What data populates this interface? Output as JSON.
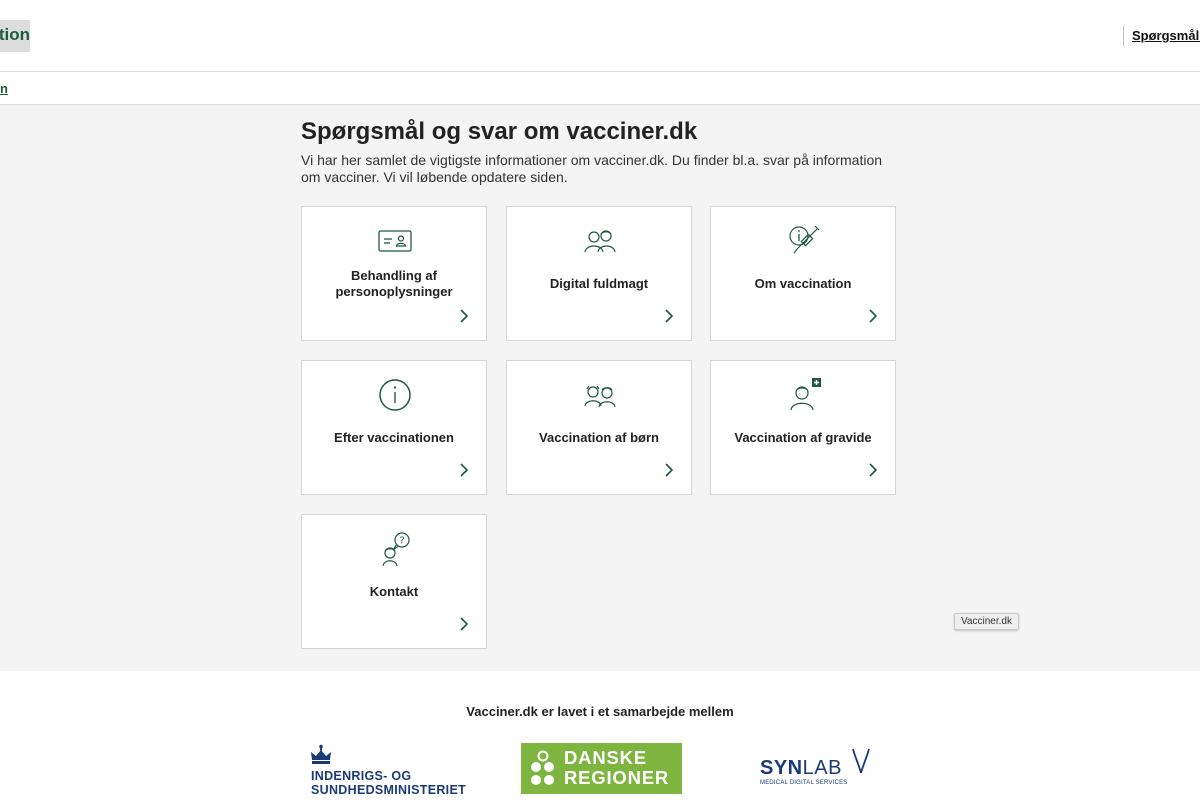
{
  "header": {
    "logo_text": "tion",
    "nav_link": "Spørgsmål o"
  },
  "subnav": {
    "link": "n"
  },
  "main": {
    "title": "Spørgsmål og svar om vacciner.dk",
    "intro": "Vi har her samlet de vigtigste informationer om vacciner.dk. Du finder bl.a. svar på information om vacciner. Vi vil løbende opdatere siden.",
    "cards": [
      {
        "title": "Behandling af personoplysninger",
        "icon": "id-card-icon"
      },
      {
        "title": "Digital fuldmagt",
        "icon": "two-people-icon"
      },
      {
        "title": "Om vaccination",
        "icon": "info-syringe-icon"
      },
      {
        "title": "Efter vaccinationen",
        "icon": "info-circle-icon"
      },
      {
        "title": "Vaccination af børn",
        "icon": "children-icon"
      },
      {
        "title": "Vaccination af gravide",
        "icon": "pregnant-person-icon"
      },
      {
        "title": "Kontakt",
        "icon": "person-question-icon"
      }
    ],
    "tooltip": "Vacciner.dk"
  },
  "footer": {
    "text": "Vacciner.dk er lavet i et samarbejde mellem",
    "partners": {
      "ministry_line1": "INDENRIGS- OG",
      "ministry_line2": "SUNDHEDSMINISTERIET",
      "regioner_line1": "DANSKE",
      "regioner_line2": "REGIONER",
      "synlab_syn": "SYN",
      "synlab_lab": "LAB",
      "synlab_sub": "MEDICAL DIGITAL SERVICES"
    }
  },
  "colors": {
    "accent_green": "#1e5a3c",
    "regioner_green": "#7db53f",
    "navy": "#1b3a7a"
  }
}
